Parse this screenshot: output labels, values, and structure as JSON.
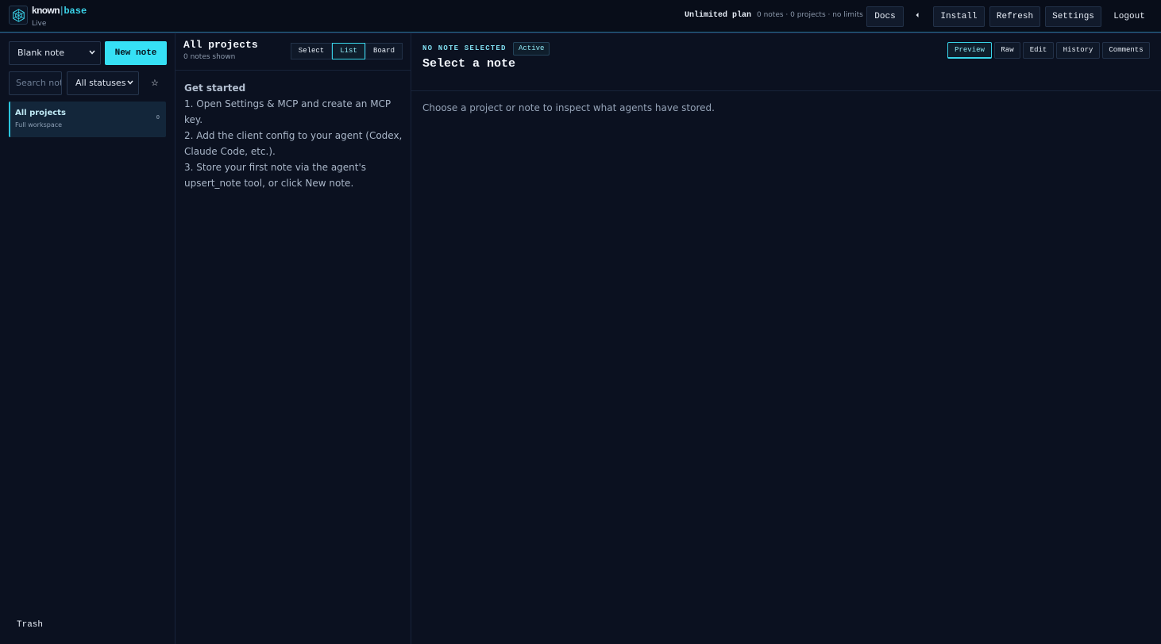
{
  "brand": {
    "word1": "known",
    "separator": "|",
    "word2": "base",
    "status": "Live",
    "logo_icon": "hexagon-network-icon"
  },
  "header": {
    "plan_name": "Unlimited plan",
    "plan_meta": "0 notes · 0 projects · no limits",
    "buttons": {
      "docs": "Docs",
      "install": "Install",
      "refresh": "Refresh",
      "settings": "Settings",
      "logout": "Logout"
    },
    "caret_icon": "caret-left-icon"
  },
  "sidebar": {
    "template_select": "Blank note",
    "new_note": "New note",
    "search_placeholder": "Search notes",
    "status_select": "All statuses",
    "star": "☆",
    "projects": [
      {
        "title": "All projects",
        "subtitle": "Full workspace",
        "count": "0"
      }
    ],
    "trash": "Trash"
  },
  "list": {
    "title": "All projects",
    "subtitle": "0 notes shown",
    "modes": {
      "select": "Select",
      "list": "List",
      "board": "Board"
    },
    "active_mode": "List",
    "get_started": {
      "title": "Get started",
      "steps": [
        "1. Open Settings & MCP and create an MCP key.",
        "2. Add the client config to your agent (Codex, Claude Code, etc.).",
        "3. Store your first note via the agent's upsert_note tool, or click New note."
      ]
    }
  },
  "detail": {
    "kicker": "NO NOTE SELECTED",
    "badge": "Active",
    "title": "Select a note",
    "tabs": {
      "preview": "Preview",
      "raw": "Raw",
      "edit": "Edit",
      "history": "History",
      "comments": "Comments"
    },
    "active_tab": "Preview",
    "empty_message": "Choose a project or note to inspect what agents have stored."
  },
  "colors": {
    "accent": "#36e0f5",
    "background": "#0b1120",
    "topbar": "#080d19"
  }
}
